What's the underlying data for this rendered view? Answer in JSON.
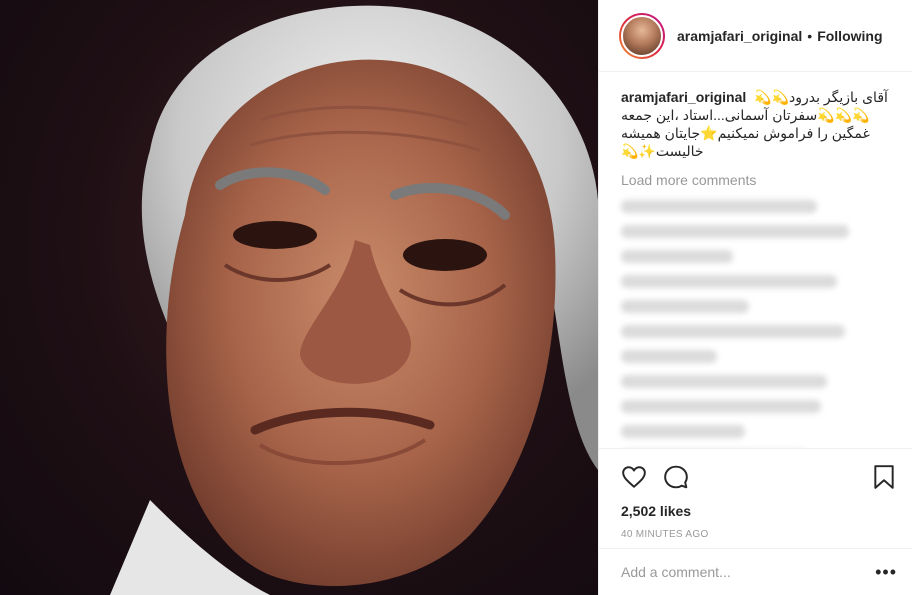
{
  "post": {
    "username": "aramjafari_original",
    "separator": "•",
    "follow_status": "Following"
  },
  "caption": {
    "username": "aramjafari_original",
    "text": "آقای بازیگر بدرود💫💫💫💫💫سفرتان آسمانی...استاد ،این جمعه غمگین را فراموش نمیکنیم⭐️جایتان همیشه خالیست✨💫"
  },
  "comments": {
    "load_more": "Load more comments"
  },
  "actions": {
    "likes": "2,502 likes",
    "timestamp": "40 MINUTES AGO"
  },
  "composer": {
    "placeholder": "Add a comment...",
    "more": "•••"
  },
  "icons": {
    "like": "heart-icon",
    "comment": "comment-icon",
    "save": "bookmark-icon"
  }
}
